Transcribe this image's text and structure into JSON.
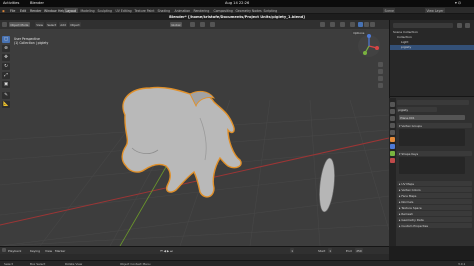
{
  "gnome": {
    "activities": "Activities",
    "app": "Blender",
    "clock": "Aug 14  22:26"
  },
  "menu": {
    "items": [
      "File",
      "Edit",
      "Render",
      "Window",
      "Help"
    ],
    "tabs": [
      "Layout",
      "Modeling",
      "Sculpting",
      "UV Editing",
      "Texture Paint",
      "Shading",
      "Animation",
      "Rendering",
      "Compositing",
      "Geometry Nodes",
      "Scripting"
    ],
    "active_tab": "Layout",
    "scene": "Scene",
    "view_layer": "View Layer"
  },
  "window_title": "Blender* [/home/kristofe/Documents/Project Units/piglety_1.blend]",
  "viewport": {
    "mode": "Object Mode",
    "view_menu": [
      "View",
      "Select",
      "Add",
      "Object"
    ],
    "orientation": "Global",
    "info_line1": "User Perspective",
    "info_line2": "(1) Collection | piglety",
    "options": "Options"
  },
  "outliner": {
    "search_placeholder": "",
    "rows": [
      {
        "label": "Scene Collection",
        "selected": false
      },
      {
        "label": "Collection",
        "selected": false
      },
      {
        "label": "Light",
        "selected": false
      },
      {
        "label": "piglety",
        "selected": true
      }
    ]
  },
  "properties": {
    "object_name": "piglety",
    "data_name": "Plane.001",
    "panels": [
      {
        "label": "Vertex Groups",
        "state": "expanded"
      },
      {
        "label": "Shape Keys",
        "state": "expanded"
      },
      {
        "label": "UV Maps",
        "state": "collapsed"
      },
      {
        "label": "Vertex Colors",
        "state": "collapsed"
      },
      {
        "label": "Face Maps",
        "state": "collapsed"
      },
      {
        "label": "Normals",
        "state": "collapsed"
      },
      {
        "label": "Texture Space",
        "state": "collapsed"
      },
      {
        "label": "Remesh",
        "state": "collapsed"
      },
      {
        "label": "Geometry Data",
        "state": "collapsed"
      },
      {
        "label": "Custom Properties",
        "state": "collapsed"
      }
    ]
  },
  "timeline": {
    "items": [
      "Playback",
      "Keying",
      "View",
      "Marker"
    ],
    "frame": "1",
    "start_label": "Start",
    "start": "1",
    "end_label": "End",
    "end": "250"
  },
  "status": {
    "select": "Select",
    "box_select": "Box Select",
    "rotate_view": "Rotate View",
    "context_menu": "Object Context Menu",
    "version": "3.0.1"
  },
  "colors": {
    "accent": "#4772b3",
    "selection_outline": "#e0902a",
    "axis_x": "#9b3535",
    "axis_y": "#6c9a2a"
  }
}
